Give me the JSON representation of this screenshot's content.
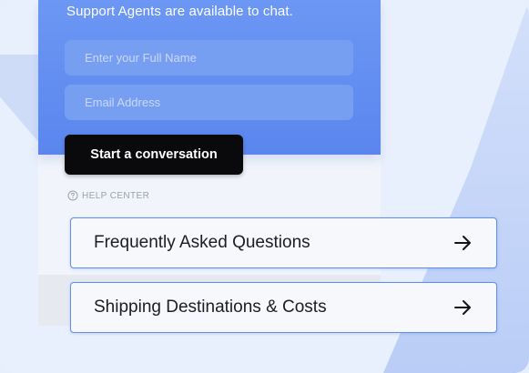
{
  "header": {
    "subtitle": "Support Agents are available to chat.",
    "name_placeholder": "Enter your Full Name",
    "email_placeholder": "Email Address",
    "cta_label": "Start a conversation"
  },
  "help_center": {
    "label": "HELP CENTER",
    "icon": "question-circle-icon"
  },
  "links": [
    {
      "label": "Frequently Asked Questions",
      "icon": "arrow-right-icon"
    },
    {
      "label": "Shipping Destinations & Costs",
      "icon": "arrow-right-icon"
    }
  ],
  "colors": {
    "header_blue": "#5f8ef2",
    "cta_black": "#0a0a0c",
    "card_border": "#5f8eef",
    "background": "#e9f0fd"
  }
}
